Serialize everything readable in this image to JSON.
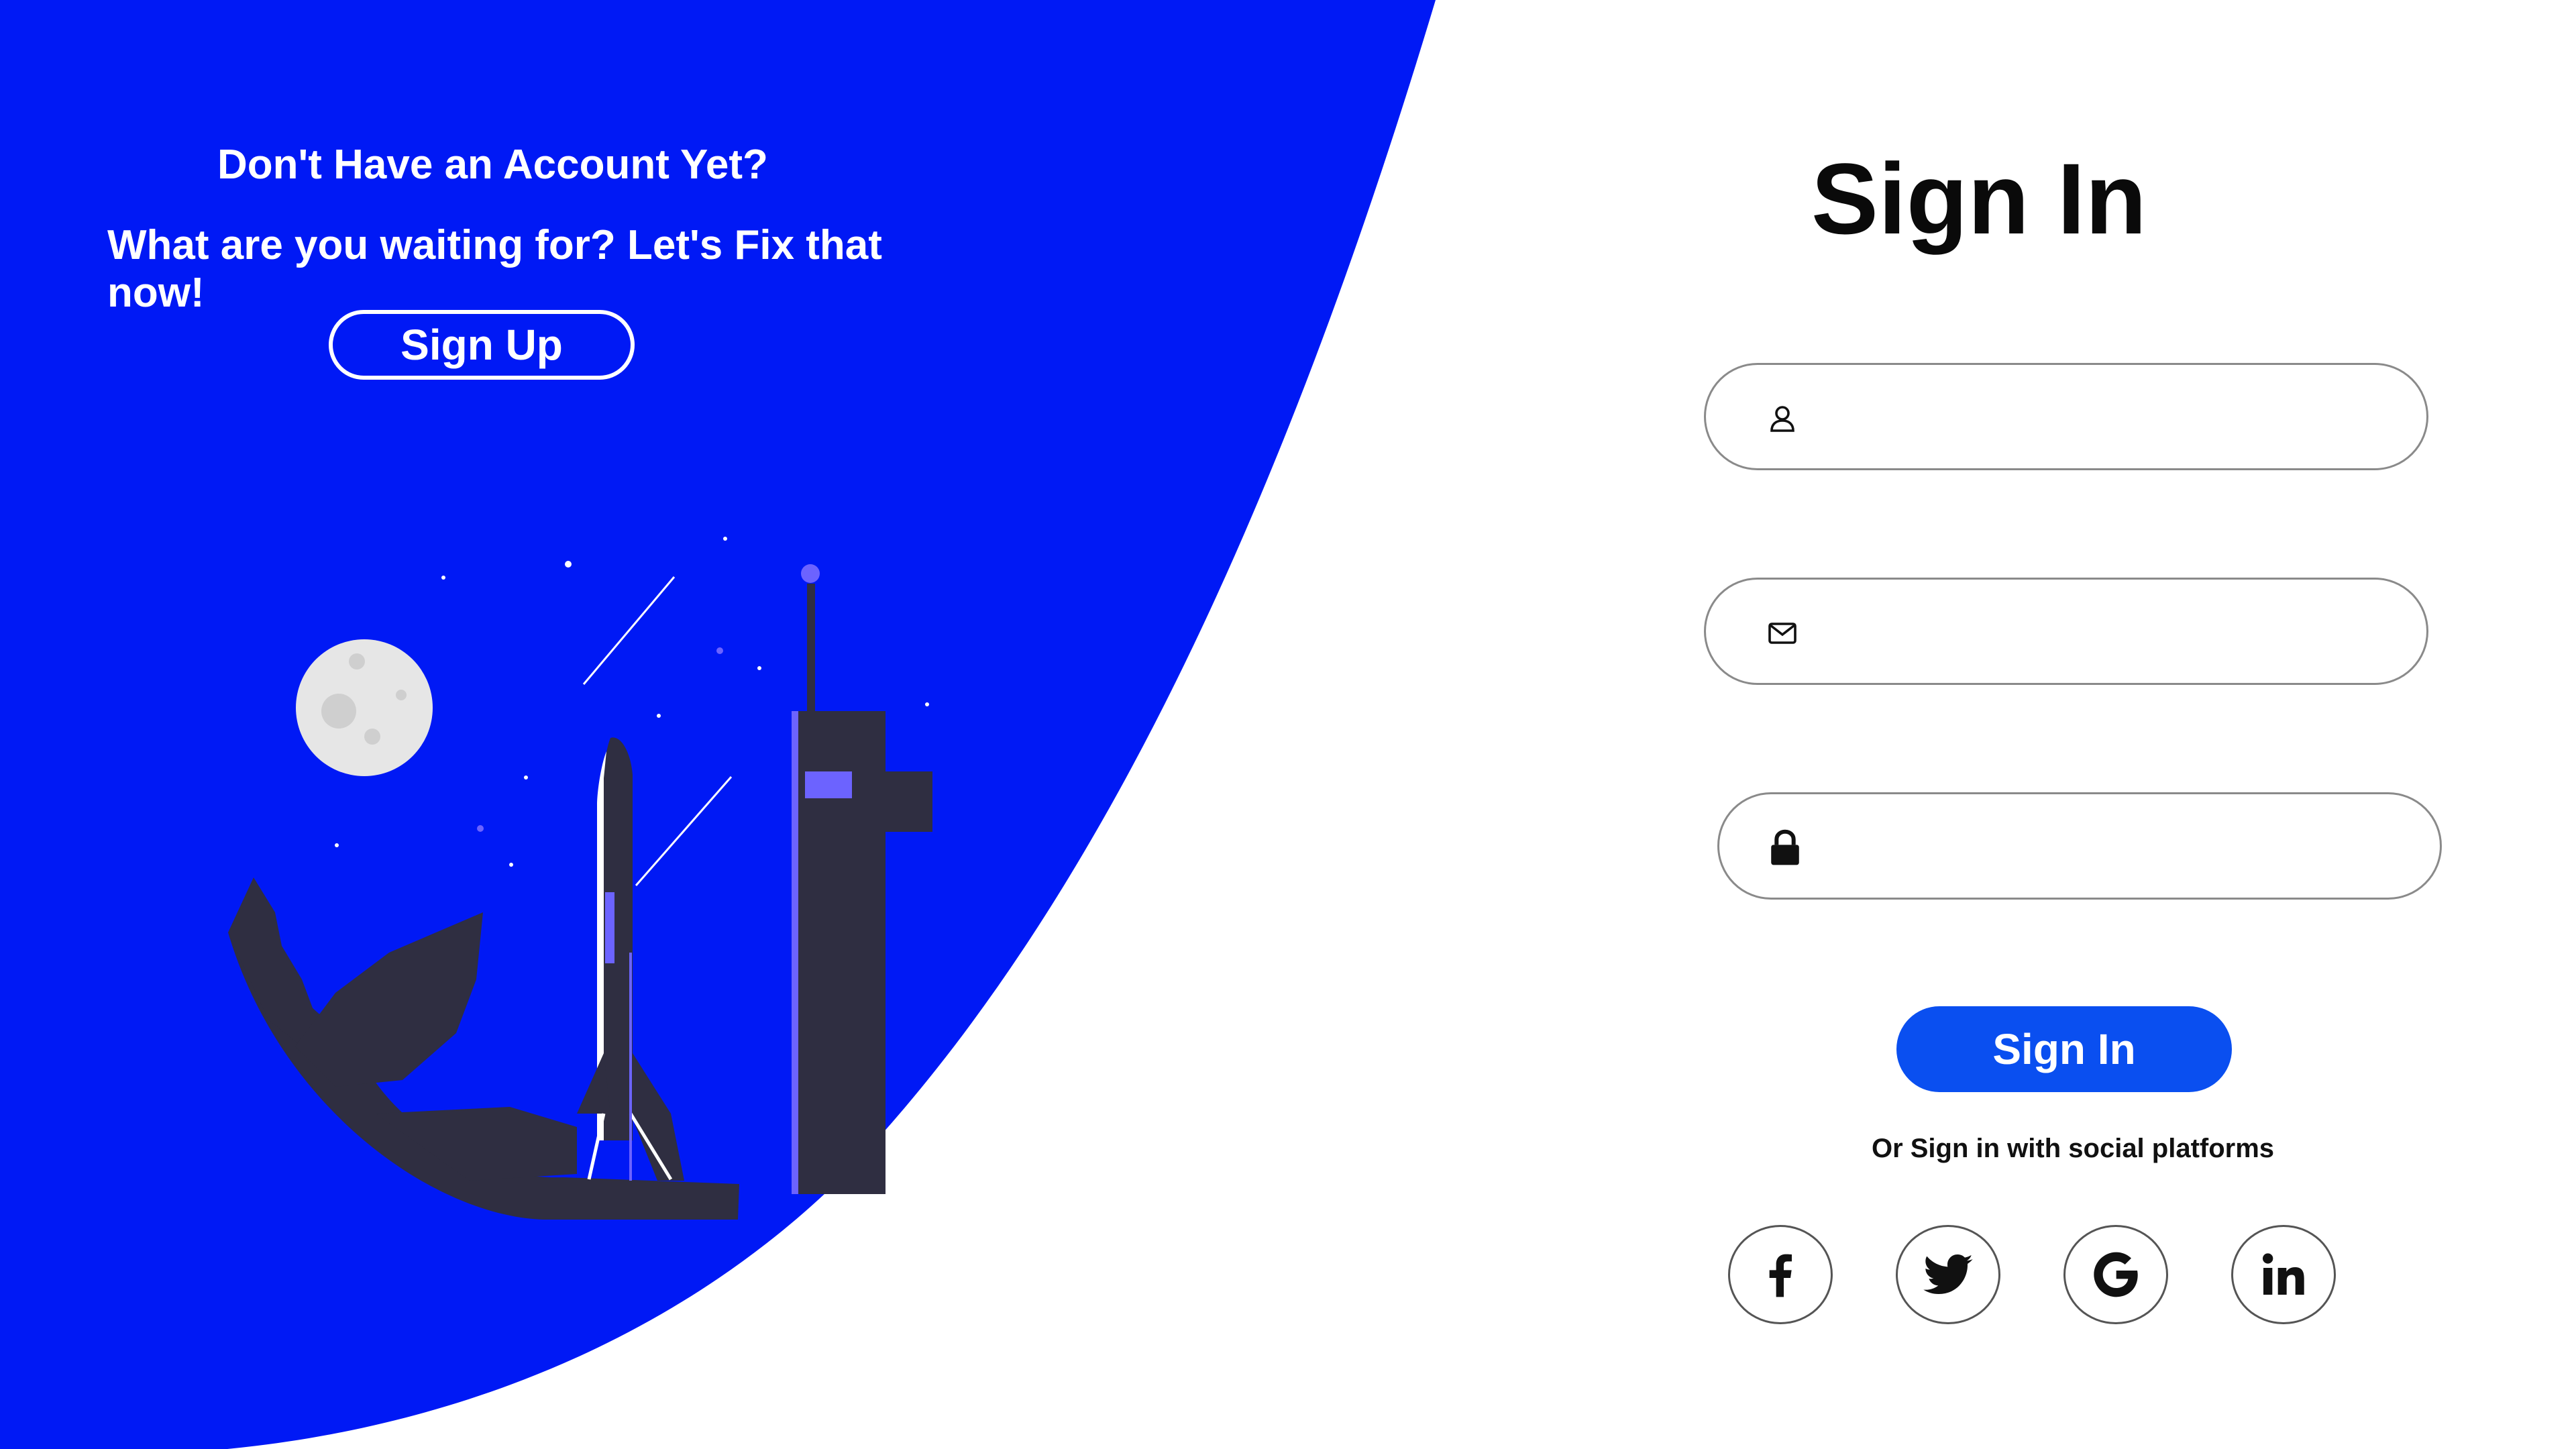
{
  "colors": {
    "brand_blue": "#0019f5",
    "button_blue": "#0a4ff0",
    "dark_ink": "#2f2e41",
    "accent_purple": "#6c63ff",
    "moon": "#e6e6e6"
  },
  "promo": {
    "heading": "Don't Have an Account Yet?",
    "subheading": "What are you waiting for? Let's Fix that now!",
    "signup_label": "Sign Up"
  },
  "signin": {
    "title": "Sign In",
    "fields": [
      {
        "icon": "user-icon",
        "value": "",
        "placeholder": ""
      },
      {
        "icon": "mail-icon",
        "value": "",
        "placeholder": ""
      },
      {
        "icon": "lock-icon",
        "value": "",
        "placeholder": ""
      }
    ],
    "button_label": "Sign In",
    "social_caption": "Or Sign in with social platforms",
    "social": [
      {
        "icon": "facebook-icon"
      },
      {
        "icon": "twitter-icon"
      },
      {
        "icon": "google-icon"
      },
      {
        "icon": "linkedin-icon"
      }
    ]
  }
}
